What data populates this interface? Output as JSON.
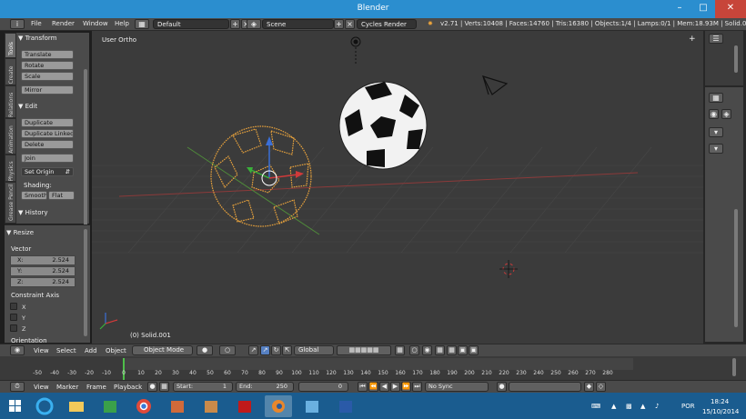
{
  "window": {
    "title": "Blender"
  },
  "info_header": {
    "menus": [
      "File",
      "Render",
      "Window",
      "Help"
    ],
    "screen_layout": "Default",
    "scene": "Scene",
    "render_engine": "Cycles Render",
    "stats": "v2.71 | Verts:10408 | Faces:14760 | Tris:16380 | Objects:1/4 | Lamps:0/1 | Mem:18.93M | Solid.001"
  },
  "tool_tabs": [
    "Tools",
    "Create",
    "Relations",
    "Animation",
    "Physics",
    "Grease Pencil"
  ],
  "toolshelf": {
    "transform": {
      "title": "Transform",
      "buttons": [
        "Translate",
        "Rotate",
        "Scale",
        "Mirror"
      ]
    },
    "edit": {
      "title": "Edit",
      "buttons": [
        "Duplicate",
        "Duplicate Linked",
        "Delete",
        "Join"
      ],
      "set_origin": "Set Origin",
      "shading_label": "Shading:",
      "smooth": "Smooth",
      "flat": "Flat"
    },
    "history": {
      "title": "History"
    }
  },
  "operator": {
    "title": "Resize",
    "vector_label": "Vector",
    "x": {
      "label": "X:",
      "value": "2.524"
    },
    "y": {
      "label": "Y:",
      "value": "2.524"
    },
    "z": {
      "label": "Z:",
      "value": "2.524"
    },
    "constraint_label": "Constraint Axis",
    "axes": [
      "X",
      "Y",
      "Z"
    ],
    "orientation_label": "Orientation"
  },
  "viewport": {
    "view_label": "User Ortho",
    "object_label": "(0) Solid.001"
  },
  "view3d_header": {
    "menus": [
      "View",
      "Select",
      "Add",
      "Object"
    ],
    "mode": "Object Mode",
    "orientation": "Global"
  },
  "timeline": {
    "ticks": [
      "-50",
      "-40",
      "-30",
      "-20",
      "-10",
      "0",
      "10",
      "20",
      "30",
      "40",
      "50",
      "60",
      "70",
      "80",
      "90",
      "100",
      "110",
      "120",
      "130",
      "140",
      "150",
      "160",
      "170",
      "180",
      "190",
      "200",
      "210",
      "220",
      "230",
      "240",
      "250",
      "260",
      "270",
      "280"
    ],
    "current_frame": 0
  },
  "timeline_header": {
    "menus": [
      "View",
      "Marker",
      "Frame",
      "Playback"
    ],
    "start": "Start:",
    "start_value": "1",
    "end": "End:",
    "end_value": "250",
    "current": "0",
    "sync": "No Sync"
  },
  "taskbar": {
    "language": "POR",
    "time": "18:24",
    "date": "15/10/2014"
  },
  "colors": {
    "title_bar": "#2b8ecf",
    "taskbar": "#1a5c8f",
    "selected_outline": "#e8a23c",
    "playhead": "#4fbe4a"
  }
}
